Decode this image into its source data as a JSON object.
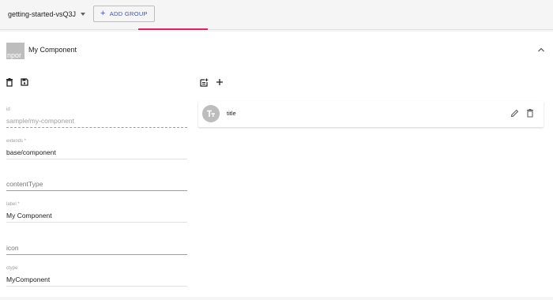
{
  "topbar": {
    "project_name": "getting-started-vsQ3J",
    "add_group_label": "ADD GROUP"
  },
  "component": {
    "thumbnail_text": "npor",
    "title": "My Component"
  },
  "fields": {
    "id": {
      "label": "id",
      "value": "sample/my-component"
    },
    "extends": {
      "label": "extends *",
      "value": "base/component"
    },
    "content_type": {
      "placeholder": "contentType"
    },
    "label": {
      "label": "label *",
      "value": "My Component"
    },
    "icon": {
      "placeholder": "icon"
    },
    "ctype": {
      "label": "ctype",
      "value": "MyComponent"
    }
  },
  "properties": [
    {
      "label": "title",
      "icon": "text-fields-icon"
    }
  ],
  "colors": {
    "accent": "#3f51b5",
    "tab_indicator": "#e91e63",
    "avatar_bg": "#bdbdbd"
  }
}
